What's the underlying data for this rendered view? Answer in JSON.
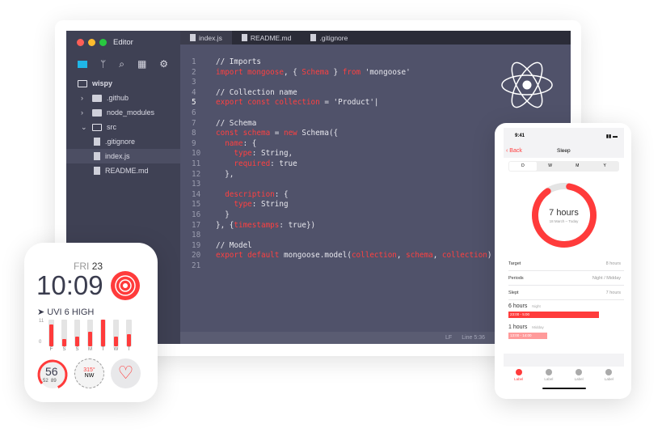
{
  "editor": {
    "title": "Editor",
    "traffic": [
      "#ff5f57",
      "#febc2e",
      "#28c840"
    ],
    "sidebar_icons": [
      "folder-icon",
      "git-branch-icon",
      "search-icon",
      "extensions-icon",
      "gear-icon"
    ],
    "tree": [
      {
        "label": "wispy",
        "type": "root"
      },
      {
        "label": ".github",
        "type": "folder"
      },
      {
        "label": "node_modules",
        "type": "folder"
      },
      {
        "label": "src",
        "type": "open-folder"
      },
      {
        "label": ".gitignore",
        "type": "file"
      },
      {
        "label": "index.js",
        "type": "file",
        "selected": true
      },
      {
        "label": "README.md",
        "type": "file"
      }
    ],
    "tabs": [
      {
        "label": "index.js",
        "active": true
      },
      {
        "label": "README.md"
      },
      {
        "label": ".gitignore"
      }
    ],
    "code": [
      [
        [
          "// Imports",
          "c"
        ]
      ],
      [
        [
          "import mongoose",
          "k"
        ],
        [
          ", { ",
          "p"
        ],
        [
          "Schema",
          "k"
        ],
        [
          " } ",
          "p"
        ],
        [
          "from",
          "k"
        ],
        [
          " 'mongoose'",
          "p"
        ]
      ],
      [],
      [
        [
          "// Collection name",
          "c"
        ]
      ],
      [
        [
          "export const collection",
          "k"
        ],
        [
          " = 'Product'|",
          "p"
        ]
      ],
      [],
      [
        [
          "// Schema",
          "c"
        ]
      ],
      [
        [
          "const schema",
          "k"
        ],
        [
          " = ",
          "p"
        ],
        [
          "new",
          "k"
        ],
        [
          " Schema({",
          "p"
        ]
      ],
      [
        [
          "  ",
          " p"
        ],
        [
          "name",
          "k"
        ],
        [
          ": {",
          "p"
        ]
      ],
      [
        [
          "    ",
          "p"
        ],
        [
          "type",
          "k"
        ],
        [
          ": String,",
          "p"
        ]
      ],
      [
        [
          "    ",
          "p"
        ],
        [
          "required",
          "k"
        ],
        [
          ": true",
          "p"
        ]
      ],
      [
        [
          "  },",
          "p"
        ]
      ],
      [],
      [
        [
          "  ",
          "p"
        ],
        [
          "description",
          "k"
        ],
        [
          ": {",
          "p"
        ]
      ],
      [
        [
          "    ",
          "p"
        ],
        [
          "type",
          "k"
        ],
        [
          ": String",
          "p"
        ]
      ],
      [
        [
          "  }",
          "p"
        ]
      ],
      [
        [
          "}, {",
          "p"
        ],
        [
          "timestamps",
          "k"
        ],
        [
          ": true})",
          "p"
        ]
      ],
      [],
      [
        [
          "// Model",
          "c"
        ]
      ],
      [
        [
          "export default",
          "k"
        ],
        [
          " mongoose.model(",
          "p"
        ],
        [
          "collection",
          "k"
        ],
        [
          ", ",
          "p"
        ],
        [
          "schema",
          "k"
        ],
        [
          ", ",
          "p"
        ],
        [
          "collection",
          "k"
        ],
        [
          ")",
          "p"
        ]
      ],
      []
    ],
    "current_line": 5,
    "status": {
      "eol": "LF",
      "position": "Line 5:36"
    },
    "accent": "#ff4040"
  },
  "watch": {
    "day": "FRI",
    "date": "23",
    "time": "10:09",
    "uvi": "UVI 6 HIGH",
    "chart_max": "11",
    "chart_min": "0",
    "days": [
      "F",
      "S",
      "S",
      "M",
      "T",
      "W",
      "T"
    ],
    "uv_values": [
      9,
      3,
      4,
      6,
      11,
      4,
      5
    ],
    "gauge": {
      "value": "56",
      "low": "52",
      "high": "89"
    },
    "compass": {
      "deg": "315°",
      "dir": "NW"
    }
  },
  "phone": {
    "time": "9:41",
    "back": "Back",
    "title": "Sleep",
    "segments": [
      "D",
      "W",
      "M",
      "Y"
    ],
    "active_segment": "D",
    "ring_label": "7 hours",
    "ring_sub": "18 March – Today",
    "ring_fraction": 0.875,
    "rows": [
      {
        "label": "Target",
        "value": "8 hours"
      },
      {
        "label": "Periods",
        "value": "Night / Midday"
      },
      {
        "label": "Slept",
        "value": "7 hours"
      }
    ],
    "periods": [
      {
        "hours": "6 hours",
        "name": "Night",
        "range": "23:00 - 5:00"
      },
      {
        "hours": "1 hours",
        "name": "Midday",
        "range": "13:00 - 14:00"
      }
    ],
    "tabbar": [
      "Label",
      "Label",
      "Label",
      "Label"
    ]
  }
}
